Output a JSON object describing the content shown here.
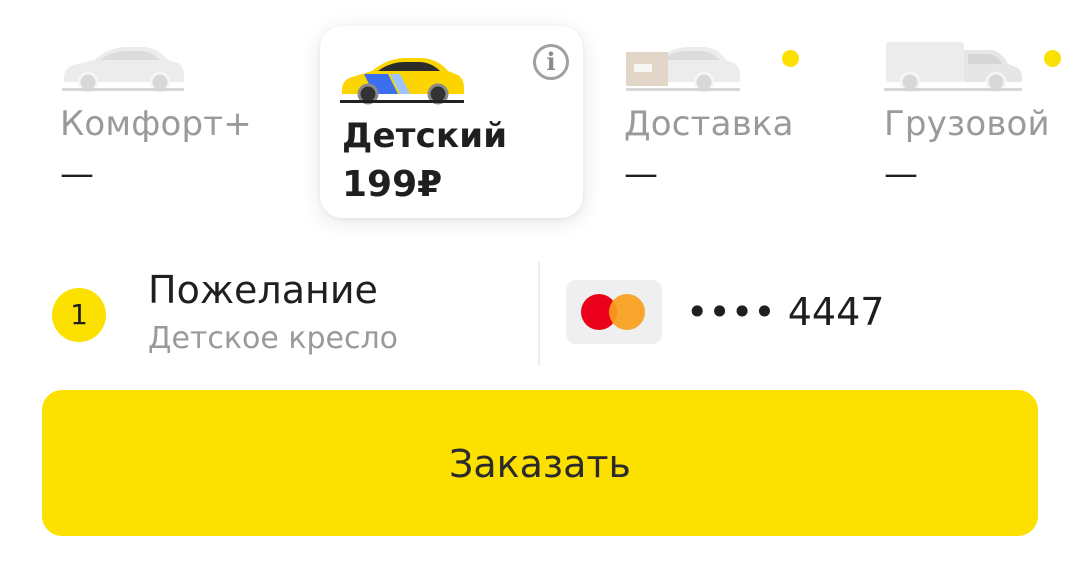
{
  "tariffs": [
    {
      "id": "comfort_plus",
      "name": "Комфорт+",
      "price": "—",
      "selected": false,
      "new_dot": false,
      "car_icon": "sedan-car-icon"
    },
    {
      "id": "kids",
      "name": "Детский",
      "price": "199₽",
      "selected": true,
      "new_dot": false,
      "car_icon": "yellow-taxi-car-icon",
      "info_glyph": "i"
    },
    {
      "id": "delivery",
      "name": "Доставка",
      "price": "—",
      "selected": false,
      "new_dot": true,
      "car_icon": "delivery-car-icon"
    },
    {
      "id": "cargo",
      "name": "Грузовой",
      "price": "—",
      "selected": false,
      "new_dot": true,
      "car_icon": "cargo-van-icon"
    }
  ],
  "requirements": {
    "count": "1",
    "title": "Пожелание",
    "subtitle": "Детское кресло"
  },
  "payment": {
    "card_brand_icon": "mastercard-icon",
    "masked_number": "•••• 4447"
  },
  "order_button": {
    "label": "Заказать"
  },
  "colors": {
    "accent": "#fce000",
    "text_primary": "#1f1f1f",
    "text_secondary": "#9a9a9a",
    "card_background": "#ffffff"
  }
}
